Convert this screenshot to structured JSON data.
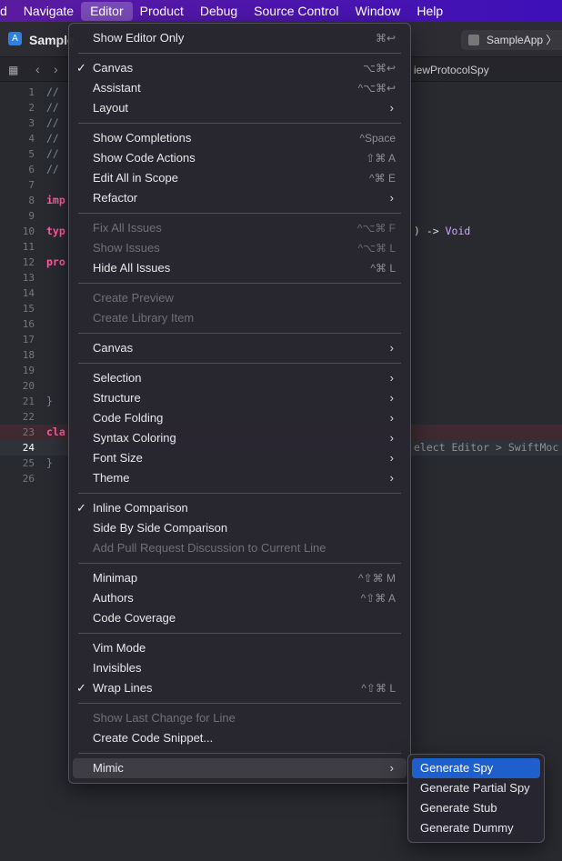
{
  "menubar": {
    "items": [
      "d",
      "Navigate",
      "Editor",
      "Product",
      "Debug",
      "Source Control",
      "Window",
      "Help"
    ],
    "active": "Editor"
  },
  "toolbar": {
    "project_title": "Sample",
    "scheme": "SampleApp"
  },
  "tabbar": {
    "label": "iewProtocolSpy"
  },
  "code": {
    "lines": [
      {
        "n": "1",
        "l": "//",
        "r": ""
      },
      {
        "n": "2",
        "l": "//",
        "r": ""
      },
      {
        "n": "3",
        "l": "//",
        "r": ""
      },
      {
        "n": "4",
        "l": "//",
        "r": ""
      },
      {
        "n": "5",
        "l": "//",
        "r": ""
      },
      {
        "n": "6",
        "l": "//",
        "r": ""
      },
      {
        "n": "7",
        "l": "",
        "r": ""
      },
      {
        "n": "8",
        "kw": "imp",
        "r": ""
      },
      {
        "n": "9",
        "l": "",
        "r": ""
      },
      {
        "n": "10",
        "kw": "typ",
        "r": ") -> ",
        "ty": "Void"
      },
      {
        "n": "11",
        "l": "",
        "r": ""
      },
      {
        "n": "12",
        "kw": "pro",
        "r": ""
      },
      {
        "n": "13"
      },
      {
        "n": "14"
      },
      {
        "n": "15"
      },
      {
        "n": "16"
      },
      {
        "n": "17"
      },
      {
        "n": "18"
      },
      {
        "n": "19"
      },
      {
        "n": "20"
      },
      {
        "n": "21",
        "l": "}"
      },
      {
        "n": "22"
      },
      {
        "n": "23",
        "kw": "cla"
      },
      {
        "n": "24",
        "r": "elect Editor > SwiftMoc"
      },
      {
        "n": "25",
        "l": "}"
      },
      {
        "n": "26"
      }
    ]
  },
  "editor_menu": {
    "groups": [
      [
        {
          "label": "Show Editor Only",
          "shortcut": "⌘↩"
        }
      ],
      [
        {
          "label": "Canvas",
          "shortcut": "⌥⌘↩",
          "checked": true
        },
        {
          "label": "Assistant",
          "shortcut": "^⌥⌘↩"
        },
        {
          "label": "Layout",
          "submenu": true
        }
      ],
      [
        {
          "label": "Show Completions",
          "shortcut": "^Space"
        },
        {
          "label": "Show Code Actions",
          "shortcut": "⇧⌘ A"
        },
        {
          "label": "Edit All in Scope",
          "shortcut": "^⌘ E"
        },
        {
          "label": "Refactor",
          "submenu": true
        }
      ],
      [
        {
          "label": "Fix All Issues",
          "shortcut": "^⌥⌘ F",
          "disabled": true
        },
        {
          "label": "Show Issues",
          "shortcut": "^⌥⌘ L",
          "disabled": true
        },
        {
          "label": "Hide All Issues",
          "shortcut": "^⌘ L"
        }
      ],
      [
        {
          "label": "Create Preview",
          "disabled": true
        },
        {
          "label": "Create Library Item",
          "disabled": true
        }
      ],
      [
        {
          "label": "Canvas",
          "submenu": true
        }
      ],
      [
        {
          "label": "Selection",
          "submenu": true
        },
        {
          "label": "Structure",
          "submenu": true
        },
        {
          "label": "Code Folding",
          "submenu": true
        },
        {
          "label": "Syntax Coloring",
          "submenu": true
        },
        {
          "label": "Font Size",
          "submenu": true
        },
        {
          "label": "Theme",
          "submenu": true
        }
      ],
      [
        {
          "label": "Inline Comparison",
          "checked": true
        },
        {
          "label": "Side By Side Comparison"
        },
        {
          "label": "Add Pull Request Discussion to Current Line",
          "disabled": true
        }
      ],
      [
        {
          "label": "Minimap",
          "shortcut": "^⇧⌘ M"
        },
        {
          "label": "Authors",
          "shortcut": "^⇧⌘ A"
        },
        {
          "label": "Code Coverage"
        }
      ],
      [
        {
          "label": "Vim Mode"
        },
        {
          "label": "Invisibles"
        },
        {
          "label": "Wrap Lines",
          "shortcut": "^⇧⌘ L",
          "checked": true
        }
      ],
      [
        {
          "label": "Show Last Change for Line",
          "disabled": true
        },
        {
          "label": "Create Code Snippet..."
        }
      ],
      [
        {
          "label": "Mimic",
          "submenu": true,
          "highlighted": true
        }
      ]
    ]
  },
  "mimic_submenu": {
    "items": [
      "Generate Spy",
      "Generate Partial Spy",
      "Generate Stub",
      "Generate Dummy"
    ],
    "selected": "Generate Spy"
  },
  "colors": {
    "menubar": "#4a14b0",
    "selection": "#1f5fcc",
    "keyword": "#fc5fa3",
    "type": "#d0a8ff"
  }
}
